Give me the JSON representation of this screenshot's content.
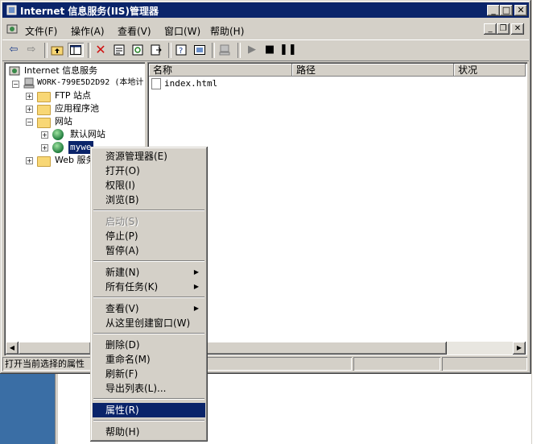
{
  "window": {
    "title": "Internet 信息服务(IIS)管理器",
    "caption_buttons": {
      "minimize": "_",
      "maximize": "□",
      "close": "✕"
    }
  },
  "menubar": {
    "items": [
      {
        "label": "文件(F)"
      },
      {
        "label": "操作(A)"
      },
      {
        "label": "查看(V)"
      },
      {
        "label": "窗口(W)"
      },
      {
        "label": "帮助(H)"
      }
    ],
    "mdi_buttons": {
      "minimize": "_",
      "restore": "❐",
      "close": "✕"
    }
  },
  "toolbar": {
    "icons": [
      "back-arrow-icon",
      "forward-arrow-icon",
      "up-folder-icon",
      "show-tree-icon",
      "delete-icon",
      "properties-icon",
      "refresh-icon",
      "export-list-icon",
      "help-icon",
      "console-icon",
      "computer-icon",
      "play-icon",
      "stop-icon",
      "pause-icon"
    ]
  },
  "tree": {
    "root": "Internet 信息服务",
    "server": "WORK-799E5D2D92 (本地计",
    "nodes": {
      "ftp": "FTP 站点",
      "apppool": "应用程序池",
      "websites": "网站",
      "default_site": "默认网站",
      "mywe": "mywe",
      "web_ext": "Web 服务"
    },
    "expander_plus": "+",
    "expander_minus": "−"
  },
  "list": {
    "columns": [
      "名称",
      "路径",
      "状况"
    ],
    "rows": [
      {
        "name": "index.html",
        "path": "",
        "status": ""
      }
    ]
  },
  "statusbar": {
    "text": "打开当前选择的属性"
  },
  "context_menu": {
    "items": [
      {
        "label": "资源管理器(E)",
        "state": "normal"
      },
      {
        "label": "打开(O)",
        "state": "normal"
      },
      {
        "label": "权限(I)",
        "state": "normal"
      },
      {
        "label": "浏览(B)",
        "state": "normal"
      },
      {
        "label": "启动(S)",
        "state": "disabled"
      },
      {
        "label": "停止(P)",
        "state": "normal"
      },
      {
        "label": "暂停(A)",
        "state": "normal"
      },
      {
        "label": "新建(N)",
        "state": "submenu"
      },
      {
        "label": "所有任务(K)",
        "state": "submenu"
      },
      {
        "label": "查看(V)",
        "state": "submenu"
      },
      {
        "label": "从这里创建窗口(W)",
        "state": "normal"
      },
      {
        "label": "删除(D)",
        "state": "normal"
      },
      {
        "label": "重命名(M)",
        "state": "normal"
      },
      {
        "label": "刷新(F)",
        "state": "normal"
      },
      {
        "label": "导出列表(L)...",
        "state": "normal"
      },
      {
        "label": "属性(R)",
        "state": "highlighted"
      },
      {
        "label": "帮助(H)",
        "state": "normal"
      }
    ],
    "submenu_arrow": "▶"
  },
  "scrollbar": {
    "left_arrow": "◀",
    "right_arrow": "▶"
  },
  "colors": {
    "titlebar": "#0a246a",
    "face": "#d4d0c8",
    "highlight": "#0a246a",
    "desktop": "#3a6ea5"
  }
}
